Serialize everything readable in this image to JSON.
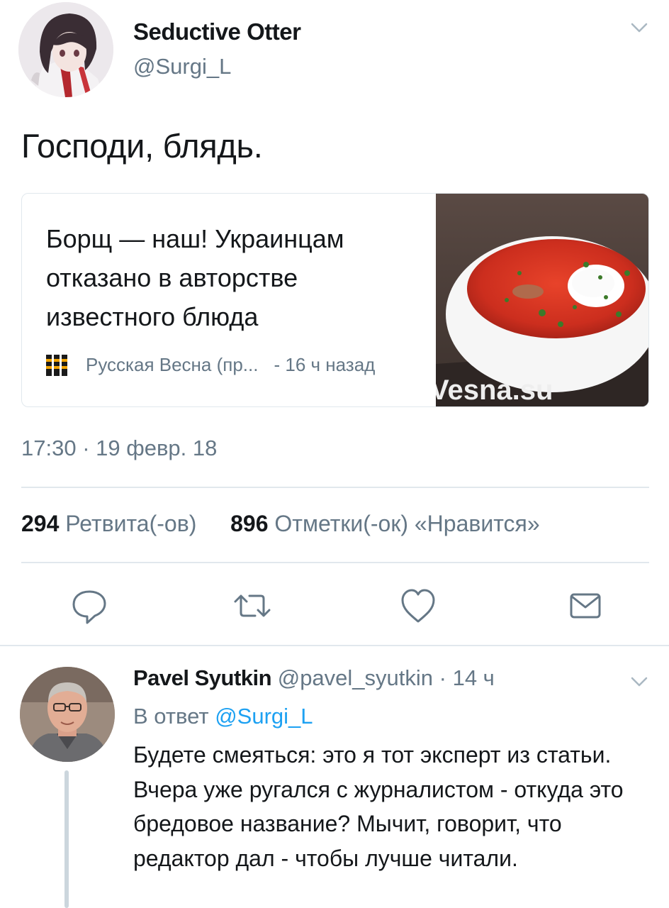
{
  "tweet": {
    "display_name": "Seductive Otter",
    "handle": "@Surgi_L",
    "text": "Господи, блядь.",
    "card": {
      "title": "Борщ — наш! Украинцам отказано в авторстве известного блюда",
      "source": "Русская Весна (пр...",
      "time": "- 16 ч назад",
      "image_watermark": "Vesna.su"
    },
    "timestamp": "17:30 · 19 февр. 18",
    "stats": {
      "retweets_count": "294",
      "retweets_label": "Ретвита(-ов)",
      "likes_count": "896",
      "likes_label": "Отметки(-ок) «Нравится»"
    },
    "actions": [
      "reply-icon",
      "retweet-icon",
      "like-icon",
      "message-icon"
    ]
  },
  "reply": {
    "display_name": "Pavel Syutkin",
    "handle": "@pavel_syutkin",
    "time": "· 14 ч",
    "reply_prefix": "В ответ",
    "reply_mention": "@Surgi_L",
    "text": "Будете смеяться: это я тот эксперт из статьи. Вчера уже ругался с журналистом - откуда это бредовое название? Мычит, говорит, что редактор дал - чтобы лучше читали."
  },
  "colors": {
    "text_primary": "#14171a",
    "text_secondary": "#657786",
    "link": "#1da1f2",
    "border": "#e1e8ed"
  }
}
